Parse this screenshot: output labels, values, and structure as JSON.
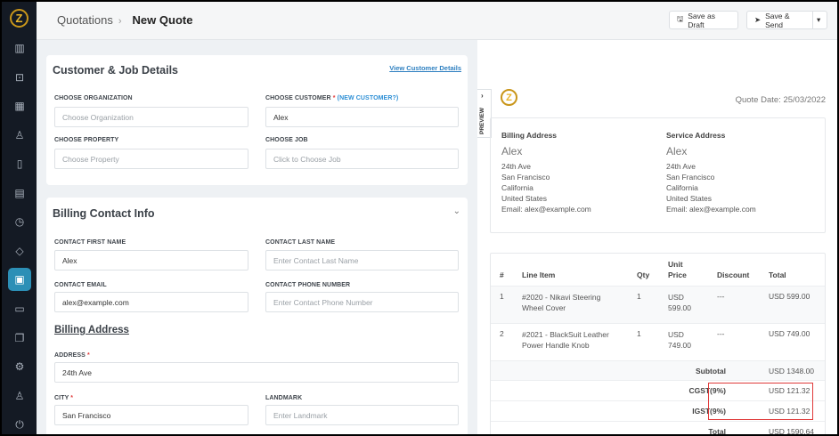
{
  "header": {
    "breadcrumb_parent": "Quotations",
    "breadcrumb_current": "New Quote",
    "save_draft": "Save as Draft",
    "save_send": "Save & Send"
  },
  "customer_card": {
    "title": "Customer & Job Details",
    "view_link": "View Customer Details",
    "org_label": "CHOOSE ORGANIZATION",
    "org_placeholder": "Choose Organization",
    "customer_label": "CHOOSE CUSTOMER",
    "customer_req": "*",
    "new_customer": "(NEW CUSTOMER?)",
    "customer_value": "Alex",
    "property_label": "CHOOSE PROPERTY",
    "property_placeholder": "Choose Property",
    "job_label": "CHOOSE JOB",
    "job_placeholder": "Click to Choose Job"
  },
  "billing_card": {
    "title": "Billing Contact Info",
    "first_label": "CONTACT FIRST NAME",
    "first_value": "Alex",
    "last_label": "CONTACT LAST NAME",
    "last_placeholder": "Enter Contact Last Name",
    "email_label": "CONTACT EMAIL",
    "email_value": "alex@example.com",
    "phone_label": "CONTACT PHONE NUMBER",
    "phone_placeholder": "Enter Contact Phone Number",
    "section": "Billing Address",
    "address_label": "ADDRESS",
    "address_value": "24th Ave",
    "city_label": "CITY",
    "city_value": "San Francisco",
    "landmark_label": "LANDMARK",
    "landmark_placeholder": "Enter Landmark",
    "req": "*"
  },
  "preview": {
    "tab": "PREVIEW",
    "quote_date": "Quote Date: 25/03/2022",
    "billing": {
      "title": "Billing Address",
      "name": "Alex",
      "l1": "24th Ave",
      "l2": "San Francisco",
      "l3": "California",
      "l4": "United States",
      "email": "Email: alex@example.com"
    },
    "service": {
      "title": "Service Address",
      "name": "Alex",
      "l1": "24th Ave",
      "l2": "San Francisco",
      "l3": "California",
      "l4": "United States",
      "email": "Email: alex@example.com"
    },
    "table": {
      "headers": [
        "#",
        "Line Item",
        "Qty",
        "Unit Price",
        "Discount",
        "Total"
      ],
      "rows": [
        {
          "n": "1",
          "item": "#2020 - Nikavi Steering Wheel Cover",
          "qty": "1",
          "price": "USD 599.00",
          "disc": "---",
          "total": "USD 599.00"
        },
        {
          "n": "2",
          "item": "#2021 - BlackSuit Leather Power Handle Knob",
          "qty": "1",
          "price": "USD 749.00",
          "disc": "---",
          "total": "USD 749.00"
        }
      ],
      "subtotal_label": "Subtotal",
      "subtotal": "USD 1348.00",
      "cgst_label": "CGST(9%)",
      "cgst": "USD 121.32",
      "igst_label": "IGST(9%)",
      "igst": "USD 121.32",
      "total_label": "Total",
      "total": "USD 1590.64"
    }
  },
  "colors": {
    "sidebar": "#141a24",
    "accent": "#2c8fb6",
    "highlight": "#e03a3a"
  }
}
